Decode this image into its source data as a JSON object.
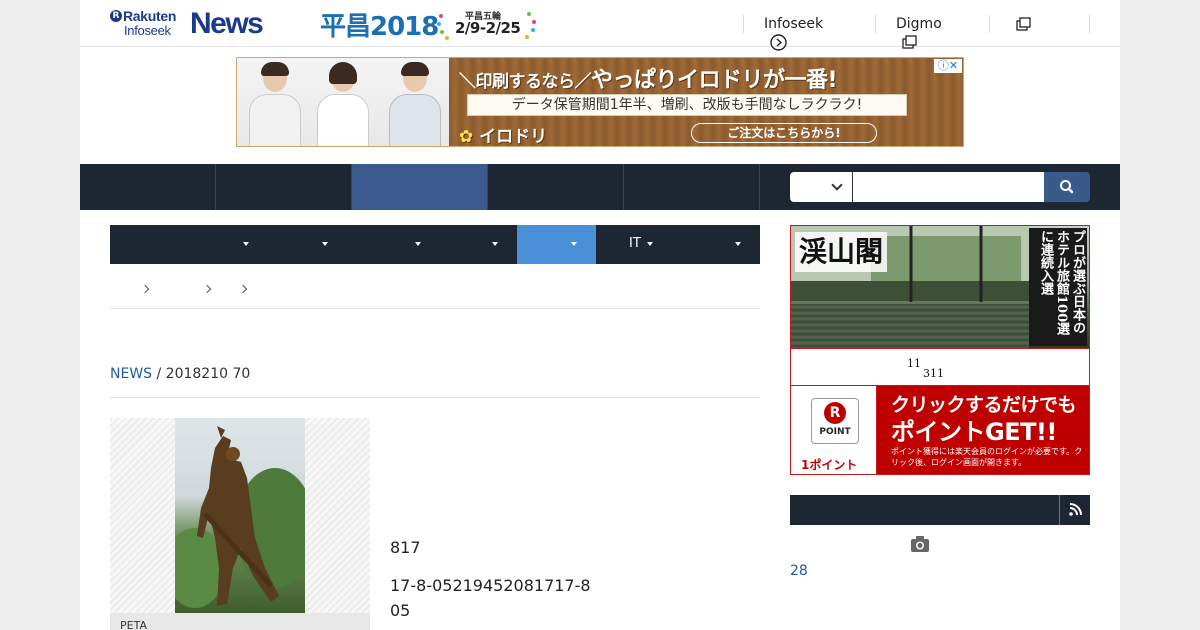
{
  "header": {
    "logo": {
      "brand_line1": "Rakuten",
      "brand_line2": "Infoseek",
      "product": "News",
      "mark": "R"
    },
    "promo": {
      "title": "平昌2018",
      "subtitle": "平昌五輪",
      "dates": "2/9-2/25"
    },
    "links": [
      {
        "label": "Infoseek",
        "icon": "arrow-circle-right-icon"
      },
      {
        "label": "Digmo",
        "icon": "window-stack-icon"
      },
      {
        "label": "",
        "icon": "window-stack-icon"
      }
    ]
  },
  "banner_ad": {
    "headline_prefix": "＼印刷するなら／",
    "headline": "やっぱりイロドリが一番!",
    "tagline": "データ保管期間1年半、増刷、改版も手間なしラクラク!",
    "brand": "イロドリ",
    "cta": "ご注文はこちらから!",
    "ad_info": "ⓘ✕",
    "colors": {
      "wood": "#8a5a2e",
      "accent": "#ffe14a"
    }
  },
  "main_nav": {
    "tabs": [
      "",
      "",
      "",
      "",
      ""
    ],
    "active_index": 2,
    "search": {
      "scope": "",
      "query": "",
      "button_icon": "search-icon"
    }
  },
  "sub_nav": {
    "items": [
      "",
      "",
      "",
      "",
      "",
      "IT",
      ""
    ],
    "active_index": 5
  },
  "breadcrumb": {
    "items": [
      "",
      "",
      "",
      ""
    ]
  },
  "article": {
    "source": "NEWS",
    "date": " / 2018210 70",
    "image_caption": "PETA",
    "paragraphs": [
      "817",
      "17-8-05219452081717-805"
    ]
  },
  "sidebar": {
    "hotel_ad": {
      "name": "渓山閣",
      "tagline": "プロが選ぶ日本のホテル旅館100選に連続入選",
      "line_a": "11",
      "line_b": "311"
    },
    "point_ad": {
      "badge_mark": "R",
      "badge_label": "POINT",
      "points": "1ポイント",
      "line1": "クリックするだけでも",
      "line2": "ポイントGET!!",
      "note": "ポイント獲得には楽天会員のログインが必要です。クリック後、ログイン画面が開きます。"
    },
    "ranking": {
      "title": "",
      "rss_icon": "rss-icon",
      "camera_icon": "camera-icon",
      "first_number": "28"
    }
  }
}
